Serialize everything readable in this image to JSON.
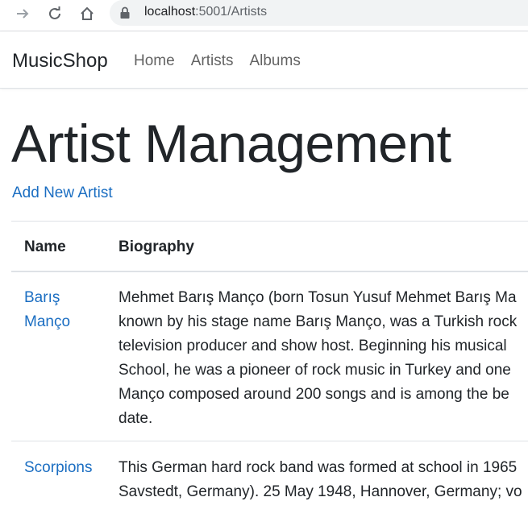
{
  "browser": {
    "url_host": "localhost",
    "url_rest": ":5001/Artists"
  },
  "navbar": {
    "brand": "MusicShop",
    "links": [
      "Home",
      "Artists",
      "Albums"
    ]
  },
  "main": {
    "title": "Artist Management",
    "add_link": "Add New Artist",
    "table": {
      "headers": [
        "Name",
        "Biography"
      ],
      "rows": [
        {
          "name_lines": [
            "Barış",
            "Manço"
          ],
          "bio_lines": [
            "Mehmet Barış Manço (born Tosun Yusuf Mehmet Barış Ma",
            "known by his stage name Barış Manço, was a Turkish rock",
            "television producer and show host. Beginning his musical",
            "School, he was a pioneer of rock music in Turkey and one",
            "Manço composed around 200 songs and is among the be",
            "date."
          ]
        },
        {
          "name_lines": [
            "Scorpions"
          ],
          "bio_lines": [
            "This German hard rock band was formed at school in 1965",
            "Savstedt, Germany). 25 May 1948, Hannover, Germany; vo"
          ]
        }
      ]
    }
  }
}
